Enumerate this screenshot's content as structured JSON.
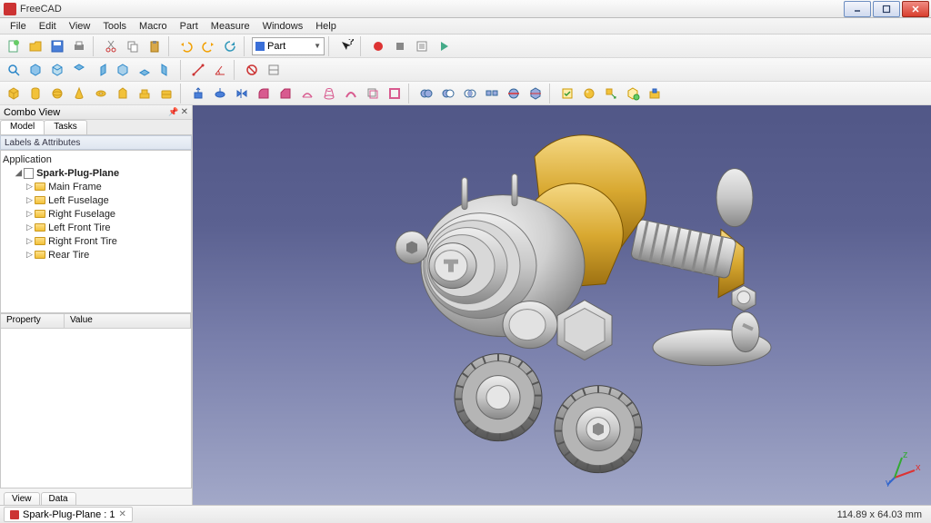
{
  "window": {
    "title": "FreeCAD"
  },
  "menu": [
    "File",
    "Edit",
    "View",
    "Tools",
    "Macro",
    "Part",
    "Measure",
    "Windows",
    "Help"
  ],
  "workbench": {
    "label": "Part"
  },
  "combo_view": {
    "title": "Combo View",
    "tabs": [
      "Model",
      "Tasks"
    ],
    "section": "Labels & Attributes",
    "app_label": "Application",
    "doc_label": "Spark-Plug-Plane",
    "parts": [
      "Main Frame",
      "Left Fuselage",
      "Right Fuselage",
      "Left Front Tire",
      "Right Front Tire",
      "Rear Tire"
    ],
    "prop_cols": [
      "Property",
      "Value"
    ],
    "bottom_tabs": [
      "View",
      "Data"
    ]
  },
  "doc_tab": {
    "label": "Spark-Plug-Plane : 1"
  },
  "status": {
    "dims": "114.89 x 64.03 mm"
  },
  "icons": {
    "row1": [
      "new-doc",
      "open",
      "save",
      "print",
      "cut",
      "copy",
      "paste",
      "undo",
      "redo",
      "refresh"
    ],
    "row2": [
      "axon",
      "fit-all",
      "fit-sel",
      "rotate-left",
      "rotate-right",
      "iso",
      "draw-style",
      "toggle",
      "measure-d",
      "measure-a",
      "measure-clear",
      "appearance"
    ],
    "row3_primitives": [
      "cube",
      "cylinder",
      "sphere",
      "cone",
      "torus",
      "prism"
    ],
    "row3_tools": [
      "wedge",
      "helix",
      "spiral",
      "circle",
      "ellipse",
      "pad",
      "pocket",
      "revolve",
      "loft"
    ],
    "row3_ops": [
      "fillet",
      "chamfer",
      "extrude",
      "sweep",
      "section",
      "offset",
      "thickness"
    ],
    "row3_bool": [
      "union",
      "difference",
      "intersect",
      "compound",
      "explode"
    ],
    "row3_check": [
      "check",
      "shape-info",
      "appearance2",
      "color",
      "mesh"
    ]
  }
}
